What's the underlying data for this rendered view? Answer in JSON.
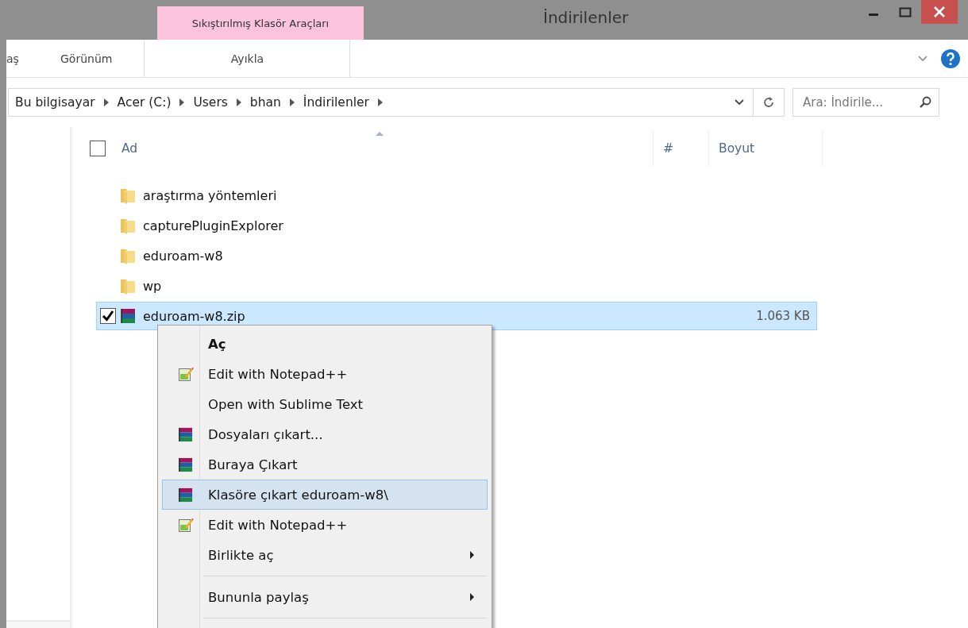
{
  "window": {
    "title": "İndirilenler"
  },
  "ribbon": {
    "context_group": "Sıkıştırılmış Klasör Araçları",
    "tabs": [
      {
        "label": "aş",
        "contextual": false
      },
      {
        "label": "Görünüm",
        "contextual": false
      },
      {
        "label": "Ayıkla",
        "contextual": true
      }
    ]
  },
  "address_bar": {
    "crumbs": [
      "Bu bilgisayar",
      "Acer (C:)",
      "Users",
      "bhan",
      "İndirilenler"
    ]
  },
  "search": {
    "placeholder": "Ara: İndirile..."
  },
  "columns": [
    {
      "label": "Ad",
      "sorted": true
    },
    {
      "label": "#",
      "sorted": false
    },
    {
      "label": "Boyut",
      "sorted": false
    }
  ],
  "select_all": {
    "checked": false
  },
  "files": [
    {
      "name": "araştırma yöntemleri",
      "kind": "folder",
      "selected": false,
      "checked": false
    },
    {
      "name": "capturePluginExplorer",
      "kind": "folder",
      "selected": false,
      "checked": false
    },
    {
      "name": "eduroam-w8",
      "kind": "folder",
      "selected": false,
      "checked": false
    },
    {
      "name": "wp",
      "kind": "folder",
      "selected": false,
      "checked": false
    },
    {
      "name": "eduroam-w8.zip",
      "kind": "archive",
      "size": "1.063 KB",
      "selected": true,
      "checked": true
    }
  ],
  "context_menu": [
    {
      "kind": "plain",
      "label": "Aç",
      "default": true,
      "submenu": false,
      "selected": false
    },
    {
      "kind": "notepad",
      "label": "Edit with Notepad++",
      "default": false,
      "submenu": false,
      "selected": false
    },
    {
      "kind": "plain",
      "label": "Open with Sublime Text",
      "default": false,
      "submenu": false,
      "selected": false
    },
    {
      "kind": "archive",
      "label": "Dosyaları çıkart...",
      "default": false,
      "submenu": false,
      "selected": false
    },
    {
      "kind": "archive",
      "label": "Buraya Çıkart",
      "default": false,
      "submenu": false,
      "selected": false
    },
    {
      "kind": "archive",
      "label": "Klasöre çıkart eduroam-w8\\",
      "default": false,
      "submenu": false,
      "selected": true
    },
    {
      "kind": "notepad",
      "label": "Edit with Notepad++",
      "default": false,
      "submenu": false,
      "selected": false
    },
    {
      "kind": "plain",
      "label": "Birlikte aç",
      "default": false,
      "submenu": true,
      "selected": false
    },
    {
      "kind": "separator"
    },
    {
      "kind": "plain",
      "label": "Bununla paylaş",
      "default": false,
      "submenu": true,
      "selected": false
    },
    {
      "kind": "separator"
    }
  ]
}
